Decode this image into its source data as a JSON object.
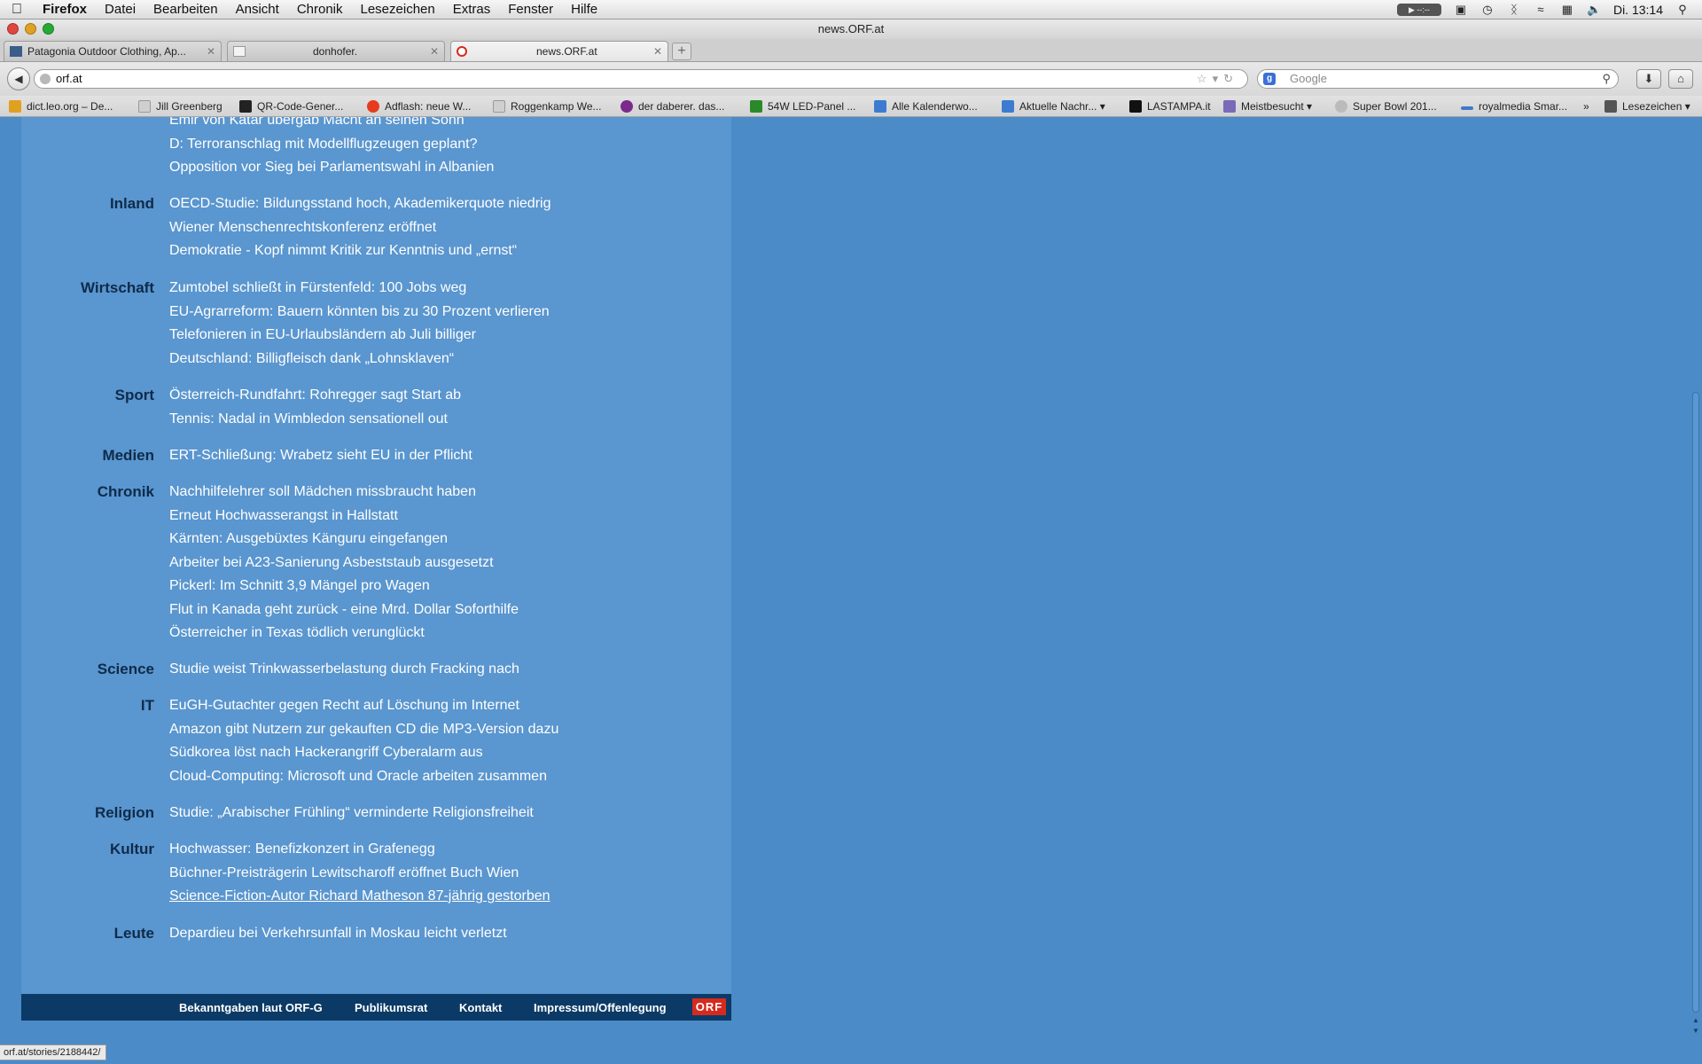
{
  "menubar": {
    "apple": "",
    "items": [
      "Firefox",
      "Datei",
      "Bearbeiten",
      "Ansicht",
      "Chronik",
      "Lesezeichen",
      "Extras",
      "Fenster",
      "Hilfe"
    ],
    "clock": "Di. 13:14"
  },
  "window": {
    "title": "news.ORF.at"
  },
  "tabs": [
    {
      "label": "Patagonia Outdoor Clothing, Ap..."
    },
    {
      "label": "donhofer."
    },
    {
      "label": "news.ORF.at"
    }
  ],
  "navbar": {
    "url": "orf.at",
    "search_placeholder": "Google"
  },
  "bookmarks": [
    {
      "label": "dict.leo.org – De...",
      "color": "#e0a020"
    },
    {
      "label": "Jill Greenberg",
      "color": "#cfcfcf"
    },
    {
      "label": "QR-Code-Gener...",
      "color": "#222222"
    },
    {
      "label": "Adflash: neue W...",
      "color": "#e53b1f"
    },
    {
      "label": "Roggenkamp We...",
      "color": "#cfcfcf"
    },
    {
      "label": "der daberer. das...",
      "color": "#7b2a8c"
    },
    {
      "label": "54W LED-Panel ...",
      "color": "#2a8a2a"
    },
    {
      "label": "Alle Kalenderwo...",
      "color": "#3d7bd1"
    },
    {
      "label": "Aktuelle Nachr...",
      "color": "#3d7bd1"
    },
    {
      "label": "LASTAMPA.it",
      "color": "#111111"
    },
    {
      "label": "Meistbesucht",
      "color": "#7a6ab8"
    },
    {
      "label": "Super Bowl 201...",
      "color": "#bbbbbb"
    },
    {
      "label": "royalmedia Smar...",
      "color": "#4477cc"
    },
    {
      "label": "Lesezeichen",
      "color": "#555555"
    }
  ],
  "sections": [
    {
      "category": "",
      "links": [
        "Emir von Katar übergab Macht an seinen Sohn",
        "D: Terroranschlag mit Modellflugzeugen geplant?",
        "Opposition vor Sieg bei Parlamentswahl in Albanien"
      ]
    },
    {
      "category": "Inland",
      "links": [
        "OECD-Studie: Bildungsstand hoch, Akademikerquote niedrig",
        "Wiener Menschenrechtskonferenz eröffnet",
        "Demokratie - Kopf nimmt Kritik zur Kenntnis und „ernst“"
      ]
    },
    {
      "category": "Wirtschaft",
      "links": [
        "Zumtobel schließt in Fürstenfeld: 100 Jobs weg",
        "EU-Agrarreform: Bauern könnten bis zu 30 Prozent verlieren",
        "Telefonieren in EU-Urlaubsländern ab Juli billiger",
        "Deutschland: Billigfleisch dank „Lohnsklaven“"
      ]
    },
    {
      "category": "Sport",
      "links": [
        "Österreich-Rundfahrt: Rohregger sagt Start ab",
        "Tennis: Nadal in Wimbledon sensationell out"
      ]
    },
    {
      "category": "Medien",
      "links": [
        "ERT-Schließung: Wrabetz sieht EU in der Pflicht"
      ]
    },
    {
      "category": "Chronik",
      "links": [
        "Nachhilfelehrer soll Mädchen missbraucht haben",
        "Erneut Hochwasserangst in Hallstatt",
        "Kärnten: Ausgebüxtes Känguru eingefangen",
        "Arbeiter bei A23-Sanierung Asbeststaub ausgesetzt",
        "Pickerl: Im Schnitt 3,9 Mängel pro Wagen",
        "Flut in Kanada geht zurück - eine Mrd. Dollar Soforthilfe",
        "Österreicher in Texas tödlich verunglückt"
      ]
    },
    {
      "category": "Science",
      "links": [
        "Studie weist Trinkwasserbelastung durch Fracking nach"
      ]
    },
    {
      "category": "IT",
      "links": [
        "EuGH-Gutachter gegen Recht auf Löschung im Internet",
        "Amazon gibt Nutzern zur gekauften CD die MP3-Version dazu",
        "Südkorea löst nach Hackerangriff Cyberalarm aus",
        "Cloud-Computing: Microsoft und Oracle arbeiten zusammen"
      ]
    },
    {
      "category": "Religion",
      "links": [
        "Studie: „Arabischer Frühling“ verminderte Religionsfreiheit"
      ]
    },
    {
      "category": "Kultur",
      "links": [
        "Hochwasser: Benefizkonzert in Grafenegg",
        "Büchner-Preisträgerin Lewitscharoff eröffnet Buch Wien",
        "Science-Fiction-Autor Richard Matheson 87-jährig gestorben"
      ]
    },
    {
      "category": "Leute",
      "links": [
        "Depardieu bei Verkehrsunfall in Moskau leicht verletzt"
      ]
    }
  ],
  "hovered_link": "Science-Fiction-Autor Richard Matheson 87-jährig gestorben",
  "footer": {
    "links": [
      "Bekanntgaben laut ORF-G",
      "Publikumsrat",
      "Kontakt",
      "Impressum/Offenlegung"
    ],
    "logo": "ORF"
  },
  "status": {
    "url": "orf.at/stories/2188442/"
  },
  "colors": {
    "page_bg": "#4a8bc8",
    "panel_bg": "#5a96cf",
    "footer_bg": "#0b3a66",
    "category_text": "#0e2b4a",
    "logo_red": "#d52b1e"
  }
}
